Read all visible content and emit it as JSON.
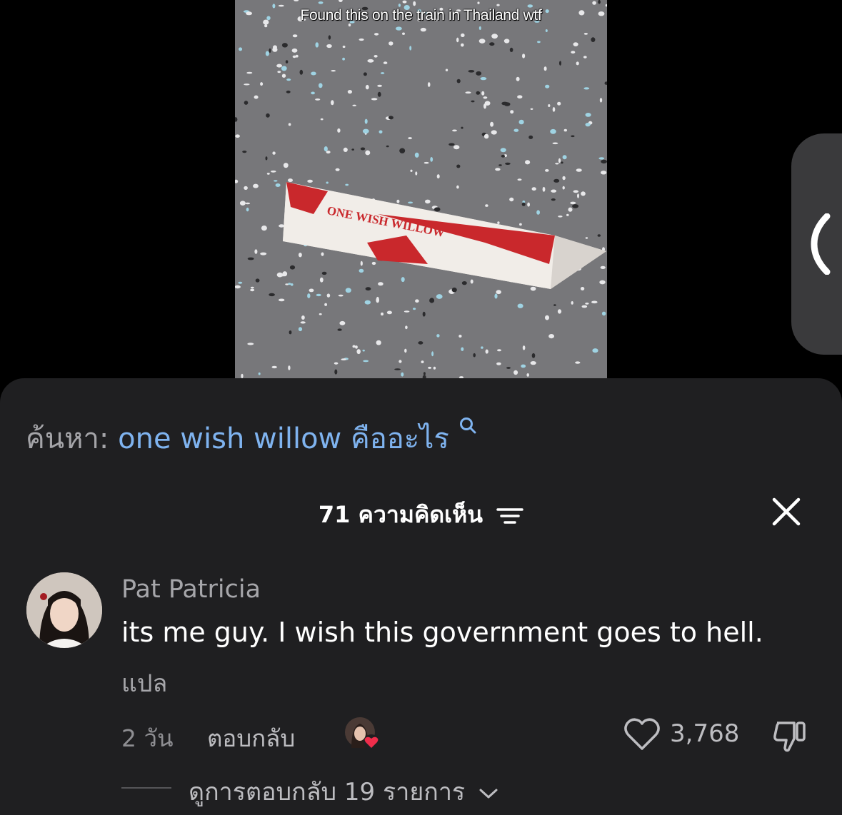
{
  "video": {
    "caption": "Found this on the train in Thailand wtf",
    "product_text": "ONE WISH WILLOW",
    "background_color": "#7a7a7c"
  },
  "side_panel": {
    "icon": "chevron-left-icon"
  },
  "search": {
    "prefix": "ค้นหา:",
    "query": "one wish willow คืออะไร",
    "icon": "search-icon",
    "query_color": "#7fb3ef"
  },
  "comments": {
    "count_label": "71 ความคิดเห็น",
    "filter_icon": "filter-icon",
    "close_icon": "close-icon"
  },
  "comment": {
    "username": "Pat Patricia",
    "text": "its me guy. I wish this government goes to hell.",
    "translate_label": "แปล",
    "time": "2 วัน",
    "reply_label": "ตอบกลับ",
    "likes": "3,768",
    "creator_liked": true
  },
  "replies": {
    "label": "ดูการตอบกลับ 19 รายการ"
  },
  "colors": {
    "panel_bg": "#1f1f21",
    "heart_accent": "#ef2d4b"
  }
}
